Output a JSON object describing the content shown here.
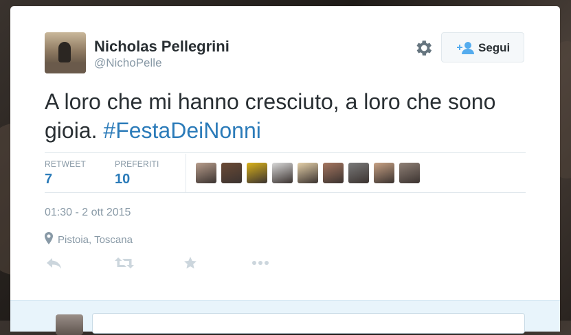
{
  "tweet": {
    "author_name": "Nicholas Pellegrini",
    "author_handle": "@NichoPelle",
    "follow_label": "Segui",
    "text_before": "A loro che mi hanno cresciuto, a loro che sono gioia. ",
    "hashtag": "#FestaDeiNonni",
    "stats": {
      "retweet_label": "RETWEET",
      "retweet_count": "7",
      "favorites_label": "PREFERITI",
      "favorites_count": "10"
    },
    "timestamp": "01:30 - 2 ott 2015",
    "location": "Pistoia, Toscana"
  },
  "favoriters": [
    {
      "name": "favoriter-1",
      "color": "#b79d8c"
    },
    {
      "name": "favoriter-2",
      "color": "#6b4a35"
    },
    {
      "name": "favoriter-3",
      "color": "#d9b21a"
    },
    {
      "name": "favoriter-4",
      "color": "#d8d8d8"
    },
    {
      "name": "favoriter-5",
      "color": "#e3cfa8"
    },
    {
      "name": "favoriter-6",
      "color": "#a57660"
    },
    {
      "name": "favoriter-7",
      "color": "#7a7a7a"
    },
    {
      "name": "favoriter-8",
      "color": "#c7a184"
    },
    {
      "name": "favoriter-9",
      "color": "#8f8076"
    }
  ],
  "colors": {
    "link": "#2b7bb9",
    "muted": "#8899a6",
    "text": "#292f33"
  },
  "icons": {
    "gear": "gear-icon",
    "follow": "add-user-icon",
    "location": "location-pin-icon",
    "reply": "reply-icon",
    "retweet": "retweet-icon",
    "favorite": "star-icon",
    "more": "more-icon"
  }
}
